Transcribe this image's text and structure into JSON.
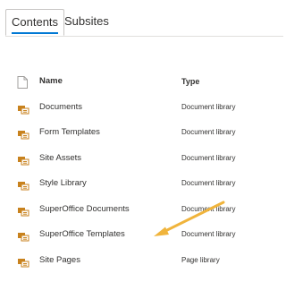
{
  "tabs": [
    {
      "label": "Contents",
      "active": true
    },
    {
      "label": "Subsites",
      "active": false
    }
  ],
  "table": {
    "columns": {
      "name": "Name",
      "type": "Type"
    },
    "rows": [
      {
        "name": "Documents",
        "type": "Document library",
        "icon": "library-icon"
      },
      {
        "name": "Form Templates",
        "type": "Document library",
        "icon": "library-icon"
      },
      {
        "name": "Site Assets",
        "type": "Document library",
        "icon": "library-icon"
      },
      {
        "name": "Style Library",
        "type": "Document library",
        "icon": "library-icon"
      },
      {
        "name": "SuperOffice Documents",
        "type": "Document library",
        "icon": "library-icon"
      },
      {
        "name": "SuperOffice Templates",
        "type": "Document library",
        "icon": "library-icon"
      },
      {
        "name": "Site Pages",
        "type": "Page library",
        "icon": "library-icon"
      }
    ]
  },
  "colors": {
    "accent": "#0078d4",
    "library_icon": "#c8821e",
    "annotation_arrow": "#f0b43c"
  }
}
